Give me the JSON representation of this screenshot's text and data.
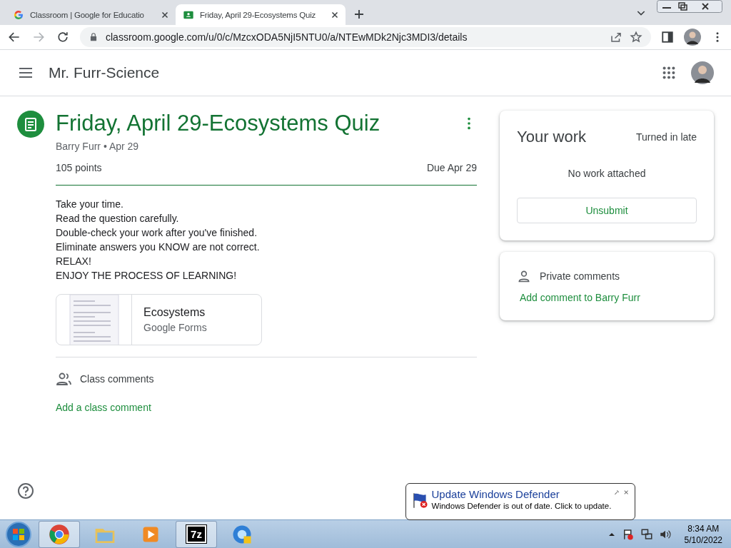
{
  "tabs": [
    {
      "kind": "google",
      "title": "Classroom | Google for Educatio",
      "selected": false
    },
    {
      "kind": "classroom",
      "title": "Friday, April 29-Ecosystems Quiz",
      "selected": true
    }
  ],
  "address": {
    "url": "classroom.google.com/u/0/c/MzcxODA5NjI5NTU0/a/NTEwMDk2Njc3MDI3/details"
  },
  "header": {
    "title": "Mr. Furr-Science"
  },
  "assignment": {
    "title": "Friday, April 29-Ecosystems Quiz",
    "byline": "Barry Furr • Apr 29",
    "points": "105 points",
    "due": "Due Apr 29",
    "instructions": [
      "Take your time.",
      "Read the question carefully.",
      "Double-check your work after you've finished.",
      "Eliminate answers you KNOW are not correct.",
      "RELAX!",
      "ENJOY THE PROCESS OF LEARNING!"
    ],
    "attachment": {
      "title": "Ecosystems",
      "type": "Google Forms"
    },
    "class_comments": {
      "label": "Class comments",
      "add": "Add a class comment"
    }
  },
  "your_work": {
    "title": "Your work",
    "status": "Turned in late",
    "empty": "No work attached",
    "button": "Unsubmit"
  },
  "private_comments": {
    "label": "Private comments",
    "add": "Add comment to Barry Furr"
  },
  "balloon": {
    "title": "Update Windows Defender",
    "message": "Windows Defender is out of date. Click to update."
  },
  "taskbar": {
    "apps": [
      {
        "kind": "chrome",
        "active": true
      },
      {
        "kind": "explorer",
        "active": false
      },
      {
        "kind": "media",
        "active": false
      },
      {
        "kind": "sevenzip",
        "label": "7z",
        "active": true
      },
      {
        "kind": "edge",
        "active": false
      }
    ],
    "time": "8:34 AM",
    "date": "5/10/2022"
  }
}
